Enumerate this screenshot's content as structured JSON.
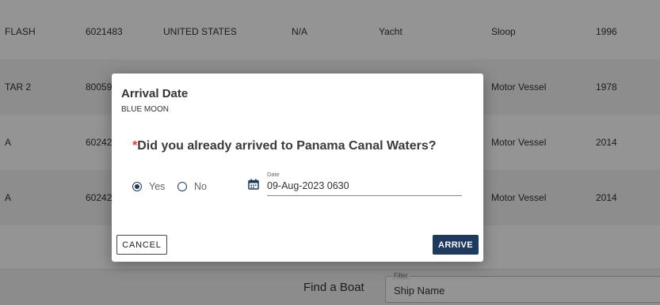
{
  "table": {
    "rows": [
      [
        "FLASH",
        "6021483",
        "UNITED STATES",
        "N/A",
        "Yacht",
        "Sloop",
        "1996"
      ],
      [
        "TAR 2",
        "80059",
        "",
        "",
        "",
        "Motor Vessel",
        "1978"
      ],
      [
        "A",
        "60242",
        "",
        "",
        "",
        "Motor Vessel",
        "2014"
      ],
      [
        "A",
        "60242",
        "",
        "",
        "",
        "Motor Vessel",
        "2014"
      ]
    ]
  },
  "footer": {
    "find_label": "Find a Boat",
    "filter_legend": "Filter",
    "filter_value": "Ship Name"
  },
  "modal": {
    "title": "Arrival Date",
    "subtitle": "BLUE MOON",
    "required_mark": "*",
    "question": "Did you already arrived to Panama Canal Waters?",
    "radio_yes": "Yes",
    "radio_no": "No",
    "selected": "Yes",
    "date_label": "Date",
    "date_value": "09-Aug-2023 0630",
    "cancel_label": "CANCEL",
    "arrive_label": "ARRIVE"
  },
  "colors": {
    "primary": "#1e3a5f",
    "required": "#e53935"
  }
}
